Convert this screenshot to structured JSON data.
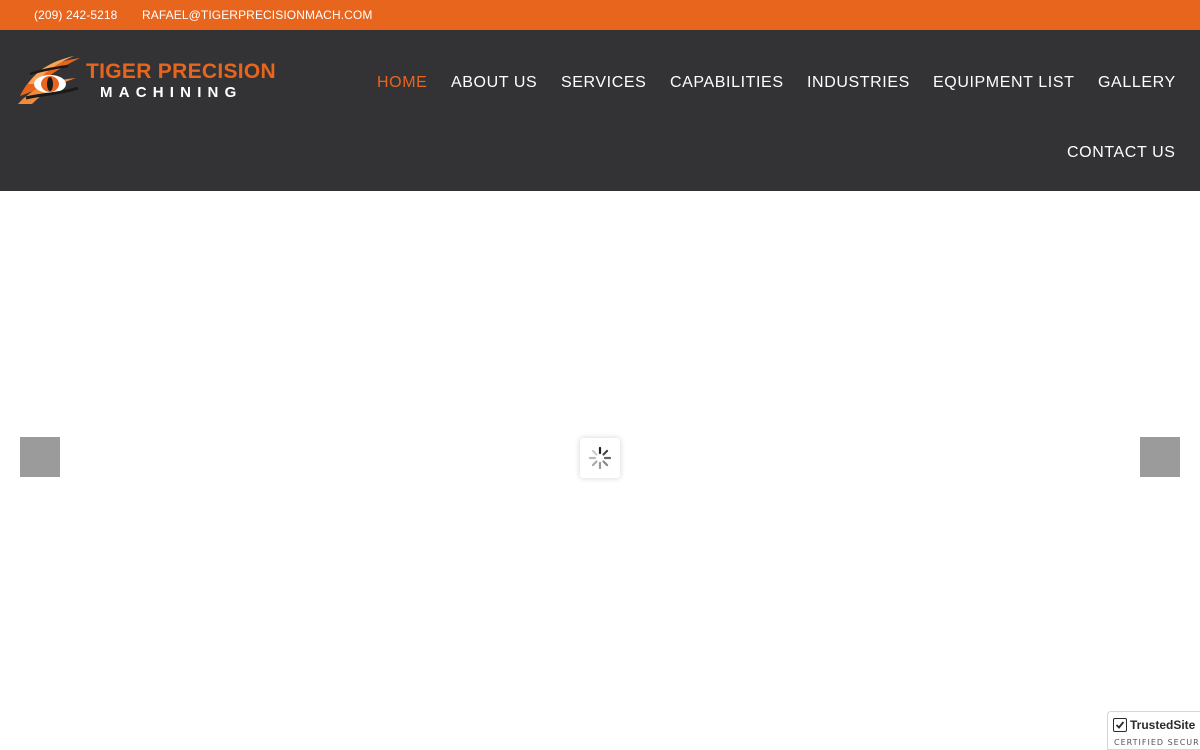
{
  "topbar": {
    "phone": "(209) 242-5218",
    "email": "RAFAEL@TIGERPRECISIONMACH.COM"
  },
  "logo": {
    "line1": "TIGER PRECISION",
    "line2": "MACHINING",
    "icon": "tiger-eye-icon"
  },
  "nav": {
    "items": [
      {
        "label": "HOME",
        "active": true
      },
      {
        "label": "ABOUT US",
        "active": false
      },
      {
        "label": "SERVICES",
        "active": false
      },
      {
        "label": "CAPABILITIES",
        "active": false
      },
      {
        "label": "INDUSTRIES",
        "active": false
      },
      {
        "label": "EQUIPMENT LIST",
        "active": false
      },
      {
        "label": "GALLERY",
        "active": false
      },
      {
        "label": "CONTACT US",
        "active": false
      }
    ]
  },
  "slider": {
    "loading_icon": "spinner-icon",
    "prev_icon": "arrow-left-icon",
    "next_icon": "arrow-right-icon"
  },
  "trusted_badge": {
    "brand": "TrustedSite",
    "subtitle": "CERTIFIED SECURE"
  },
  "colors": {
    "accent": "#e8651e",
    "header_bg": "#333335",
    "nav_text": "#ffffff"
  }
}
